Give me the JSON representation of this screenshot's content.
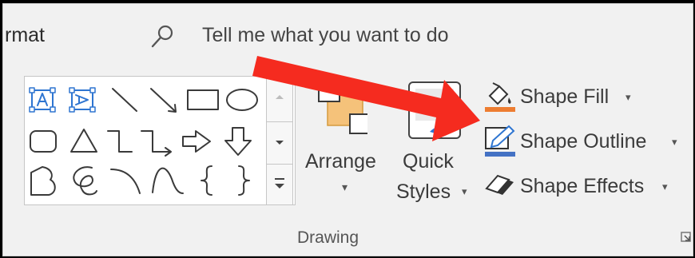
{
  "ribbon": {
    "tab_label": "rmat",
    "search": {
      "text": "Tell me what you want to do",
      "icon": "search-icon"
    }
  },
  "gallery": {
    "shapes": [
      "text-box",
      "vertical-text-box",
      "line",
      "arrow-line",
      "rectangle",
      "oval",
      "rounded-rectangle",
      "triangle",
      "elbow-connector",
      "elbow-arrow-connector",
      "right-arrow",
      "down-arrow",
      "freeform-shape",
      "scribble",
      "arc",
      "curve",
      "left-brace",
      "right-brace"
    ],
    "scroll_up": "up-arrow",
    "scroll_down": "down-arrow",
    "more": "more"
  },
  "arrange": {
    "label": "Arrange",
    "dropdown": "▾"
  },
  "quick_styles": {
    "line1": "Quick",
    "line2": "Styles",
    "dropdown": "▾"
  },
  "commands": {
    "shape_fill": {
      "label": "Shape Fill",
      "dropdown": "▾",
      "accent": "#ed7d31"
    },
    "shape_outline": {
      "label": "Shape Outline",
      "dropdown": "▾",
      "accent": "#4472c4"
    },
    "shape_effects": {
      "label": "Shape Effects",
      "dropdown": "▾"
    }
  },
  "group": {
    "label": "Drawing"
  },
  "colors": {
    "annotation_arrow": "#f52b1f",
    "icon_blue": "#2e75d1",
    "arrange_fill": "#f5c27a"
  }
}
